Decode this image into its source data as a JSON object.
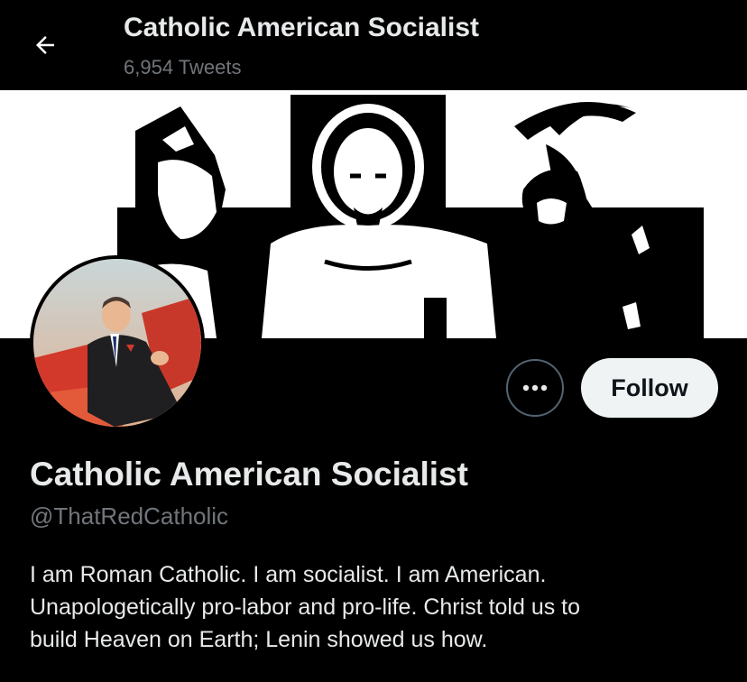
{
  "header": {
    "title": "Catholic American Socialist",
    "tweet_count": "6,954 Tweets",
    "back_icon": "arrow-left-icon"
  },
  "banner": {
    "description_icon": "banner-image"
  },
  "actions": {
    "more_icon": "ellipsis-icon",
    "follow_label": "Follow"
  },
  "profile": {
    "display_name": "Catholic American Socialist",
    "handle": "@ThatRedCatholic",
    "bio_lines": [
      "I am Roman Catholic. I am socialist. I am American.",
      "Unapologetically pro-labor and pro-life. Christ told us to",
      "build Heaven on Earth; Lenin showed us how."
    ]
  },
  "colors": {
    "background": "#000000",
    "primary_text": "#e7e9ea",
    "secondary_text": "#71767b",
    "follow_bg": "#eff3f4",
    "outline": "#536471"
  }
}
